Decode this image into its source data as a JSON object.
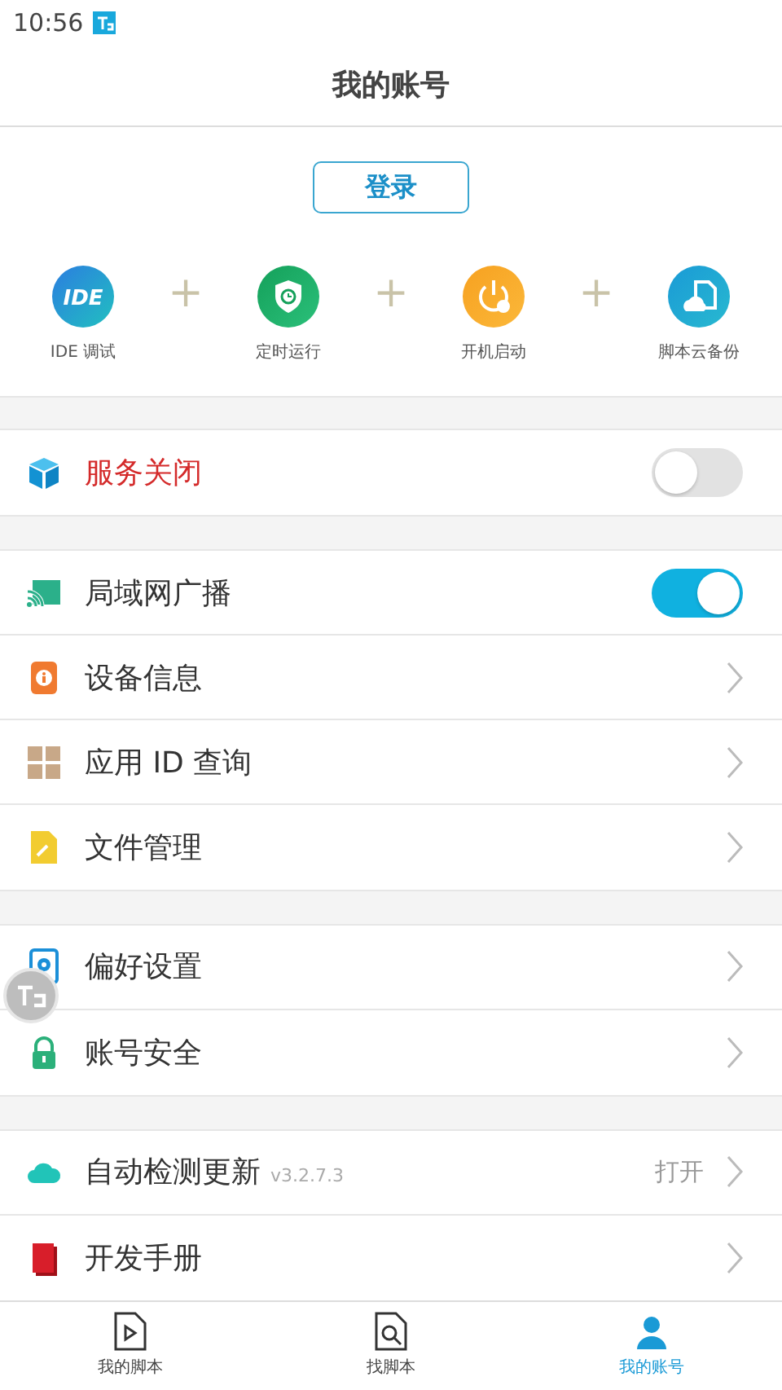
{
  "status_bar": {
    "time": "10:56"
  },
  "header": {
    "title": "我的账号"
  },
  "login_button": "登录",
  "features": [
    {
      "label": "IDE 调试",
      "badge": "IDE"
    },
    {
      "label": "定时运行"
    },
    {
      "label": "开机启动"
    },
    {
      "label": "脚本云备份"
    }
  ],
  "feature_separator": "+",
  "sections": [
    [
      {
        "kind": "switch",
        "label": "服务关闭",
        "color": "#d42a2a",
        "on": false
      }
    ],
    [
      {
        "kind": "switch",
        "label": "局域网广播",
        "on": true
      },
      {
        "kind": "link",
        "label": "设备信息"
      },
      {
        "kind": "link",
        "label": "应用 ID 查询"
      },
      {
        "kind": "link",
        "label": "文件管理"
      }
    ],
    [
      {
        "kind": "link",
        "label": "偏好设置"
      },
      {
        "kind": "link",
        "label": "账号安全"
      }
    ],
    [
      {
        "kind": "link",
        "label": "自动检测更新",
        "note": "v3.2.7.3",
        "value": "打开"
      },
      {
        "kind": "link",
        "label": "开发手册"
      }
    ]
  ],
  "tabs": [
    {
      "label": "我的脚本",
      "selected": false
    },
    {
      "label": "找脚本",
      "selected": false
    },
    {
      "label": "我的账号",
      "selected": true
    }
  ]
}
